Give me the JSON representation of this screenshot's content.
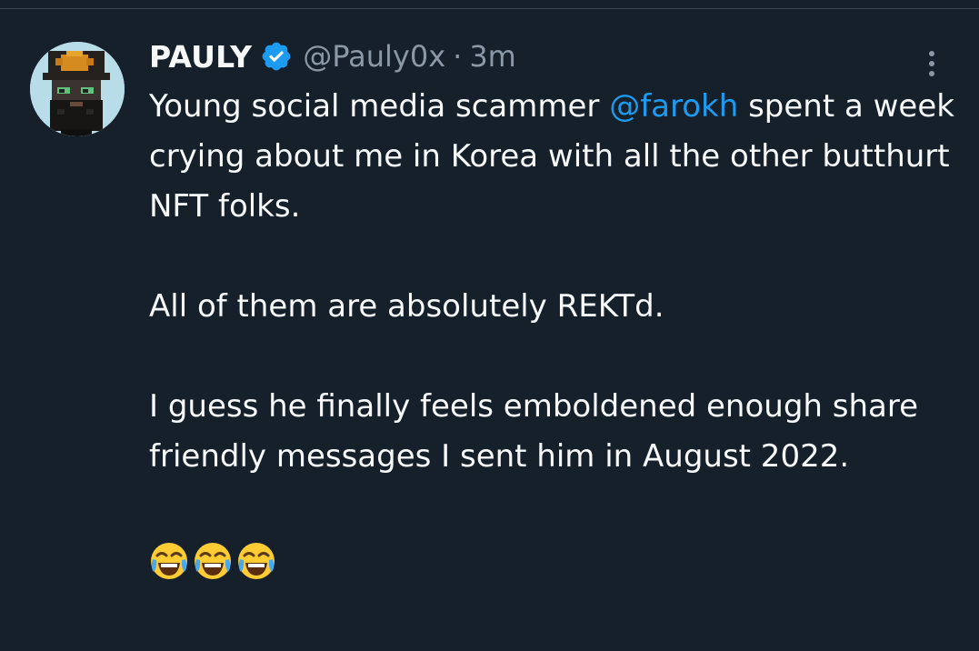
{
  "tweet": {
    "display_name": "PAULY",
    "handle": "@Pauly0x",
    "separator": "·",
    "timestamp": "3m",
    "text": {
      "line1_before_mention": "Young social media scammer ",
      "mention": "@farokh",
      "line1_after_mention": " spent a week crying about me in Korea with all the other butthurt NFT folks.",
      "paragraph2": "All of them are absolutely REKTd.",
      "paragraph3": "I guess he finally feels emboldened enough share friendly messages I sent him in August 2022."
    },
    "emojis": [
      "face-with-tears-of-joy",
      "face-with-tears-of-joy",
      "face-with-tears-of-joy"
    ],
    "verified": true,
    "icons": {
      "verified": "verified-badge-icon",
      "more": "more-vertical-icon",
      "avatar": "pixel-punk-avatar"
    }
  },
  "colors": {
    "background": "#15202b",
    "text": "#f7f9f9",
    "muted": "#8b98a5",
    "link": "#1d9bf0",
    "verified": "#1d9bf0",
    "divider": "#38444d"
  }
}
